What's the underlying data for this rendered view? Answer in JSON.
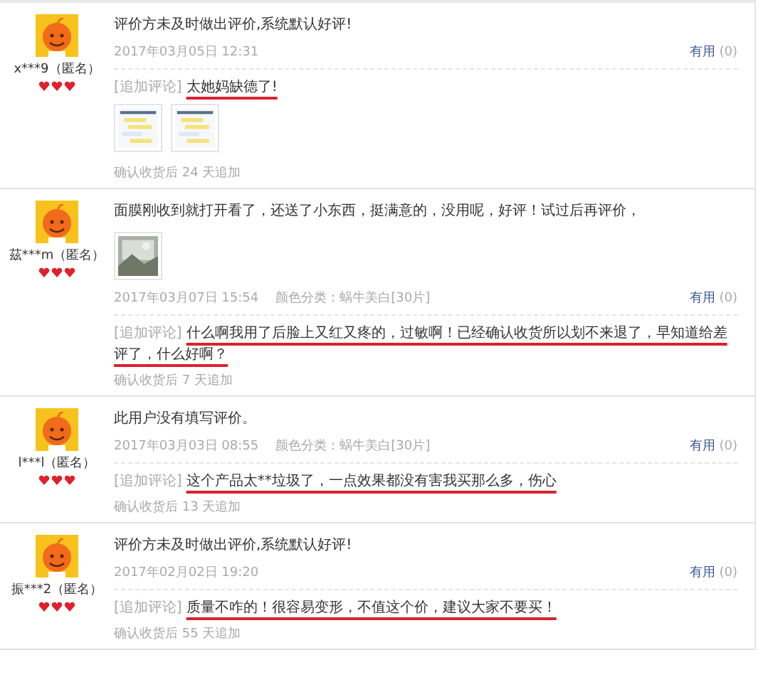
{
  "reviews": [
    {
      "user": "x***9（匿名）",
      "stars": 3,
      "text": "评价方未及时做出评价,系统默认好评!",
      "date": "2017年03月05日 12:31",
      "useful": "有用",
      "useful_count": "(0)",
      "followup": {
        "label": "[追加评论]",
        "text": "太她妈缺德了!",
        "underlined": true,
        "photos": [
          {
            "kind": "picture"
          },
          {
            "kind": "picture"
          }
        ],
        "note": "确认收货后 24 天追加"
      }
    },
    {
      "user": "茲***m（匿名）",
      "stars": 3,
      "text": "面膜刚收到就打开看了，还送了小东西，挺满意的，没用呢，好评！试过后再评价，",
      "photos": [
        {
          "kind": "picture"
        }
      ],
      "date": "2017年03月07日 15:54",
      "variant": "颜色分类：蜗牛美白[30片]",
      "useful": "有用",
      "useful_count": "(0)",
      "followup": {
        "label": "[追加评论]",
        "text": "什么啊我用了后脸上又红又疼的，过敏啊！已经确认收货所以划不来退了，早知道给差评了，什么好啊？",
        "underlined": true,
        "note": "确认收货后 7 天追加"
      }
    },
    {
      "user": "l***l（匿名）",
      "stars": 3,
      "text": "此用户没有填写评价。",
      "date": "2017年03月03日 08:55",
      "variant": "颜色分类：蜗牛美白[30片]",
      "useful": "有用",
      "useful_count": "(0)",
      "followup": {
        "label": "[追加评论]",
        "text": "这个产品太**垃圾了，一点效果都没有害我买那么多，伤心",
        "underlined": true,
        "note": "确认收货后 13 天追加"
      }
    },
    {
      "user": "振***2（匿名）",
      "stars": 3,
      "text": "评价方未及时做出评价,系统默认好评!",
      "date": "2017年02月02日 19:20",
      "useful": "有用",
      "useful_count": "(0)",
      "followup": {
        "label": "[追加评论]",
        "text": "质量不咋的！很容易变形，不值这个价，建议大家不要买！",
        "underlined": true,
        "note": "确认收货后 55 天追加"
      }
    }
  ]
}
